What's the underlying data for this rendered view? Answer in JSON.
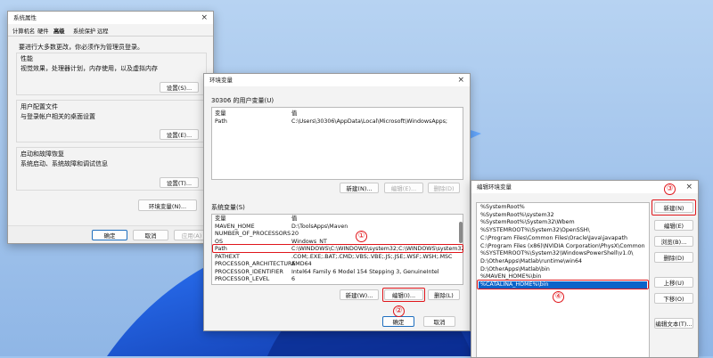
{
  "sysprops": {
    "title": "系统属性",
    "tabs": [
      "计算机名",
      "硬件",
      "高级",
      "系统保护",
      "远程"
    ],
    "admin_note": "要进行大多数更改，你必须作为管理员登录。",
    "perf": {
      "label": "性能",
      "desc": "视觉效果，处理器计划，内存使用，以及虚拟内存",
      "button": "设置(S)..."
    },
    "profile": {
      "label": "用户配置文件",
      "desc": "与登录帐户相关的桌面设置",
      "button": "设置(E)..."
    },
    "startup": {
      "label": "启动和故障恢复",
      "desc": "系统启动、系统故障和调试信息",
      "button": "设置(T)..."
    },
    "env_button": "环境变量(N)...",
    "ok": "确定",
    "cancel": "取消",
    "apply": "应用(A)"
  },
  "envvars": {
    "title": "环境变量",
    "user_label": "30306 的用户变量(U)",
    "col_var": "变量",
    "col_val": "值",
    "user_rows": [
      {
        "name": "Path",
        "value": "C:\\Users\\30306\\AppData\\Local\\Microsoft\\WindowsApps;"
      }
    ],
    "user_buttons": {
      "new": "新建(N)...",
      "edit": "编辑(E)...",
      "delete": "删除(D)"
    },
    "sys_label": "系统变量(S)",
    "sys_rows": [
      {
        "name": "MAVEN_HOME",
        "value": "D:\\ToolsApps\\Maven"
      },
      {
        "name": "NUMBER_OF_PROCESSORS",
        "value": "20"
      },
      {
        "name": "OS",
        "value": "Windows_NT"
      },
      {
        "name": "Path",
        "value": "C:\\WINDOWS\\C:\\WINDOWS\\system32;C:\\WINDOWS\\system32\\W..."
      },
      {
        "name": "PATHEXT",
        "value": ".COM;.EXE;.BAT;.CMD;.VBS;.VBE;.JS;.JSE;.WSF;.WSH;.MSC"
      },
      {
        "name": "PROCESSOR_ARCHITECTURE",
        "value": "AMD64"
      },
      {
        "name": "PROCESSOR_IDENTIFIER",
        "value": "Intel64 Family 6 Model 154 Stepping 3, GenuineIntel"
      },
      {
        "name": "PROCESSOR_LEVEL",
        "value": "6"
      }
    ],
    "sys_buttons": {
      "new": "新建(W)...",
      "edit": "编辑(I)...",
      "delete": "删除(L)"
    },
    "ok": "确定",
    "cancel": "取消"
  },
  "editenv": {
    "title": "编辑环境变量",
    "items": [
      "%SystemRoot%",
      "%SystemRoot%\\system32",
      "%SystemRoot%\\System32\\Wbem",
      "%SYSTEMROOT%\\System32\\OpenSSH\\",
      "C:\\Program Files\\Common Files\\Oracle\\Java\\javapath",
      "C:\\Program Files (x86)\\NVIDIA Corporation\\PhysX\\Common",
      "%SYSTEMROOT%\\System32\\WindowsPowerShell\\v1.0\\",
      "D:\\OtherApps\\Matlab\\runtime\\win64",
      "D:\\OtherApps\\Matlab\\bin",
      "%MAVEN_HOME%\\bin",
      "%CATALINA_HOME%\\bin"
    ],
    "selected_index": 10,
    "buttons": {
      "new": "新建(N)",
      "edit": "编辑(E)",
      "browse": "浏览(B)...",
      "delete": "删除(D)",
      "up": "上移(U)",
      "down": "下移(O)",
      "edit_text": "编辑文本(T)..."
    }
  },
  "annotations": [
    "①",
    "②",
    "③",
    "④"
  ],
  "colors": {
    "accent": "#0a63c9",
    "annotation": "#e0161b",
    "window_bg": "#f3f3f3"
  }
}
